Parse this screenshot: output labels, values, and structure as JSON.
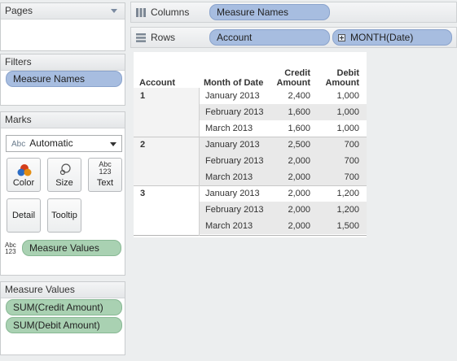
{
  "cards": {
    "pages": {
      "title": "Pages"
    },
    "filters": {
      "title": "Filters",
      "pills": [
        "Measure Names"
      ]
    },
    "marks": {
      "title": "Marks",
      "mark_type": {
        "prefix": "Abc",
        "value": "Automatic"
      },
      "buttons": {
        "color": "Color",
        "size": "Size",
        "text": "Text",
        "detail": "Detail",
        "tooltip": "Tooltip"
      },
      "text_icon_top": "Abc",
      "text_icon_bottom": "123",
      "assigned_pill": "Measure Values"
    },
    "measure_values": {
      "title": "Measure Values",
      "pills": [
        "SUM(Credit Amount)",
        "SUM(Debit Amount)"
      ]
    }
  },
  "shelves": {
    "columns": {
      "label": "Columns",
      "pills": [
        "Measure Names"
      ]
    },
    "rows": {
      "label": "Rows",
      "pills": [
        "Account",
        "MONTH(Date)"
      ]
    }
  },
  "table": {
    "headers": {
      "account": "Account",
      "month": "Month of Date",
      "credit_line1": "Credit",
      "credit_line2": "Amount",
      "debit_line1": "Debit",
      "debit_line2": "Amount"
    },
    "groups": [
      {
        "account": "1",
        "rows": [
          {
            "month": "January 2013",
            "credit": "2,400",
            "debit": "1,000"
          },
          {
            "month": "February 2013",
            "credit": "1,600",
            "debit": "1,000"
          },
          {
            "month": "March 2013",
            "credit": "1,600",
            "debit": "1,000"
          }
        ]
      },
      {
        "account": "2",
        "rows": [
          {
            "month": "January 2013",
            "credit": "2,500",
            "debit": "700"
          },
          {
            "month": "February 2013",
            "credit": "2,000",
            "debit": "700"
          },
          {
            "month": "March 2013",
            "credit": "2,000",
            "debit": "700"
          }
        ]
      },
      {
        "account": "3",
        "rows": [
          {
            "month": "January 2013",
            "credit": "2,000",
            "debit": "1,200"
          },
          {
            "month": "February 2013",
            "credit": "2,000",
            "debit": "1,200"
          },
          {
            "month": "March 2013",
            "credit": "2,000",
            "debit": "1,500"
          }
        ]
      }
    ]
  },
  "colors": {
    "dimension_pill": "#a7bde0",
    "measure_pill": "#a9d1b2",
    "band": "#e9e9e9"
  }
}
